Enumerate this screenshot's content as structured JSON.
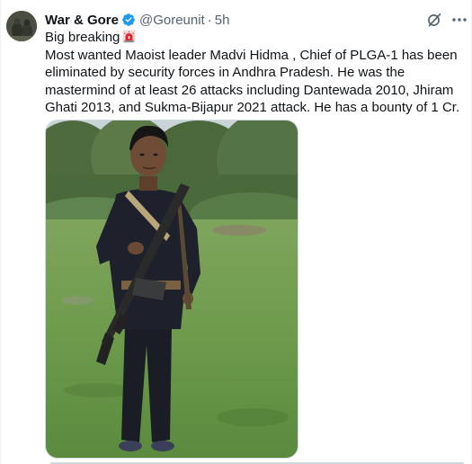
{
  "tweet": {
    "author_name": "War & Gore",
    "author_handle": "@Goreunit",
    "separator": "·",
    "time": "5h",
    "first_line": "Big breaking",
    "first_line_emoji": "rotating-light-icon",
    "body": "Most wanted Maoist leader Madvi Hidma , Chief of PLGA-1 has been eliminated by security forces in Andhra Pradesh. He was the mastermind of at least 26 attacks including Dantewada 2010, Jhiram Ghati 2013, and Sukma-Bijapur 2021 attack. He has a bounty of 1 Cr."
  },
  "icons": {
    "verified": "verified-badge-icon",
    "grok": "grok-icon",
    "more": "more-dots-icon"
  },
  "colors": {
    "text_primary": "#0f1419",
    "text_secondary": "#536471",
    "verified_blue": "#1d9bf0",
    "siren_red": "#e0262e",
    "border": "#cfd9de"
  }
}
